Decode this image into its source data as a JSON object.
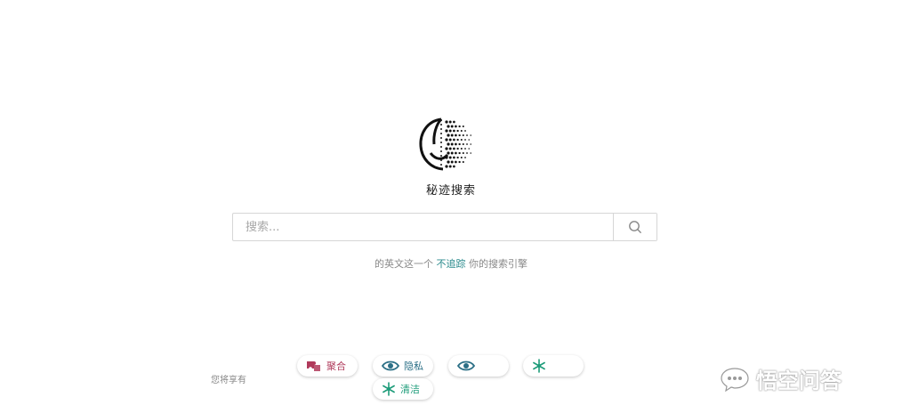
{
  "brand": {
    "name": "秘迹搜索"
  },
  "search": {
    "placeholder": "搜索..."
  },
  "tagline": {
    "prefix": "的英文这一个",
    "highlight": "不追踪",
    "suffix": "你的搜索引擎"
  },
  "features": {
    "label": "您将享有",
    "items": [
      {
        "label": "聚合",
        "icon": "puzzle-icon"
      },
      {
        "label": "隐私",
        "icon": "eye-icon"
      },
      {
        "label": "",
        "icon": "eye-icon"
      },
      {
        "label": "",
        "icon": "snowflake-icon"
      },
      {
        "label": "清洁",
        "icon": "snowflake-icon"
      }
    ]
  },
  "watermark": {
    "text": "悟空问答",
    "icon": "chat-bubble-icon"
  },
  "colors": {
    "accent": "#2a8a8c",
    "aggregate": "#b03a5b",
    "privacy": "#2b6f86",
    "clean": "#1e9c7a"
  }
}
